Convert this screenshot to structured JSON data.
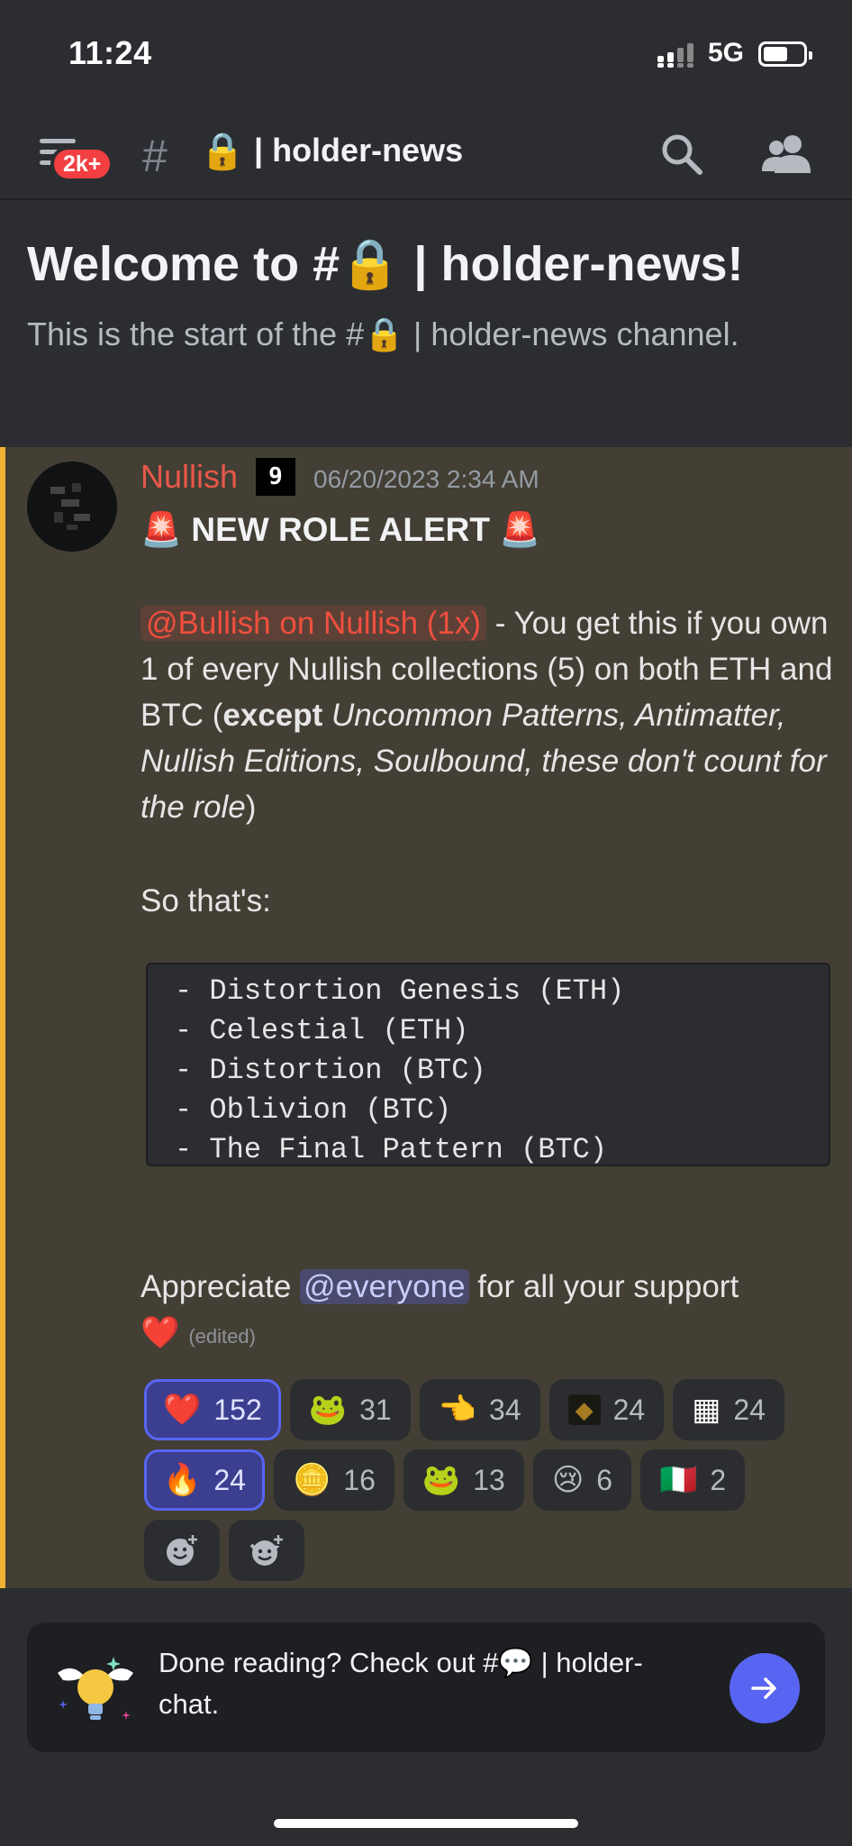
{
  "status_bar": {
    "time": "11:24",
    "network": "5G"
  },
  "header": {
    "notification_badge": "2k+",
    "hash": "#",
    "lock_emoji": "🔒",
    "channel_name": "| holder-news",
    "icons": [
      "menu-icon",
      "search-icon",
      "members-icon"
    ]
  },
  "welcome": {
    "title_prefix": "Welcome to #",
    "title_lock": "🔒",
    "title_suffix": " | holder-news!",
    "subtitle_prefix": "This is the start of the #",
    "subtitle_lock": "🔒",
    "subtitle_suffix": " | holder-news channel."
  },
  "message": {
    "author": "Nullish",
    "author_tag": "9",
    "timestamp": "06/20/2023 2:34 AM",
    "alert_emoji": "🚨",
    "alert_text": "NEW ROLE ALERT",
    "role_mention": "@Bullish on Nullish (1x)",
    "para1_a": " - You get this if you own 1 of every Nullish collections (5) on both ETH and BTC (",
    "para1_bold": "except",
    "para1_italic": " Uncommon Patterns, Antimatter, Nullish Editions, Soulbound, these don't count for the role",
    "para1_end": ")",
    "para2": "So that's:",
    "code_lines": [
      "- Distortion Genesis (ETH)",
      "- Celestial (ETH)",
      "- Distortion (BTC)",
      "- Oblivion (BTC)",
      "- The Final Pattern (BTC)"
    ],
    "para3_a": "Appreciate ",
    "everyone_mention": "@everyone",
    "para3_b": " for all your support",
    "heart": "❤️",
    "edited": "(edited)",
    "reactions_row1": [
      {
        "emoji": "❤️",
        "count": "152",
        "me": true
      },
      {
        "emoji": "🐸",
        "count": "31",
        "me": false
      },
      {
        "emoji": "👈",
        "count": "34",
        "me": false
      },
      {
        "emoji": "◆",
        "count": "24",
        "me": false
      },
      {
        "emoji": "▦",
        "count": "24",
        "me": false
      }
    ],
    "reactions_row2": [
      {
        "emoji": "🔥",
        "count": "24",
        "me": true
      },
      {
        "emoji": "🪙",
        "count": "16",
        "me": false
      },
      {
        "emoji": "🐸",
        "count": "13",
        "me": false
      },
      {
        "emoji": "😢",
        "count": "6",
        "me": false
      },
      {
        "emoji": "🇮🇹",
        "count": "2",
        "me": false
      }
    ]
  },
  "prompt": {
    "text_a": "Done reading? Check out #",
    "chat_emoji": "💬",
    "text_b": " | holder-chat."
  },
  "colors": {
    "background": "#2b2d31",
    "message_highlight": "#433f35",
    "highlight_bar": "#f0b232",
    "author": "#e8584a",
    "role_mention": "#f04f3f",
    "accent": "#5865f2",
    "badge": "#f23f42"
  }
}
